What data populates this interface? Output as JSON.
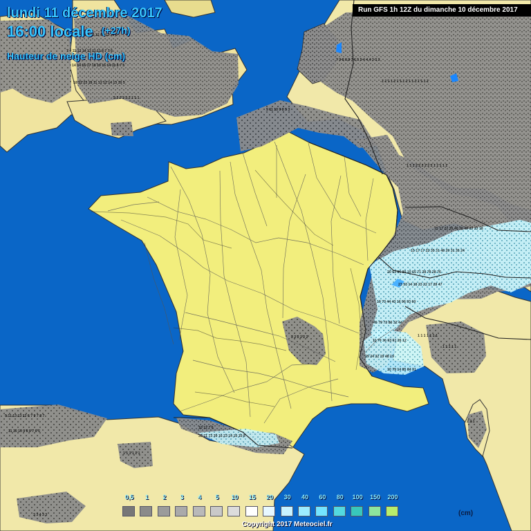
{
  "map": {
    "date_title": "lundi 11 décembre 2017",
    "time_title": "16:00 locale",
    "offset": "(+27h)",
    "variable_title": "Hauteur de neige HD (cm)",
    "run_banner": "Run GFS 1h 12Z du dimanche 10 décembre 2017",
    "legend_unit": "(cm)",
    "copyright": "Copyright 2017 Meteociel.fr"
  },
  "legend": {
    "labels": [
      "0,5",
      "1",
      "2",
      "3",
      "4",
      "5",
      "10",
      "15",
      "20",
      "30",
      "40",
      "60",
      "80",
      "100",
      "150",
      "200"
    ],
    "colors": [
      "#777777",
      "#8a8a8a",
      "#9b9b9b",
      "#aaaaaa",
      "#b9b9b9",
      "#c9c9c9",
      "#dcdcdc",
      "#ffffff",
      "#e7f8ff",
      "#c7f2ff",
      "#9cecff",
      "#74e4ff",
      "#54d9df",
      "#39c7bb",
      "#8ee59d",
      "#b8ee6c"
    ]
  },
  "colors": {
    "sea": "#0a66c7",
    "france": "#f2ee7d",
    "neighbor_land": "#f1e8a9",
    "grey_snow": "#8a8a8a",
    "white_snow": "#e8e8e8",
    "cyan_snow": "#6ee2ff"
  },
  "icons": {
    "map": "snow-depth-map"
  }
}
